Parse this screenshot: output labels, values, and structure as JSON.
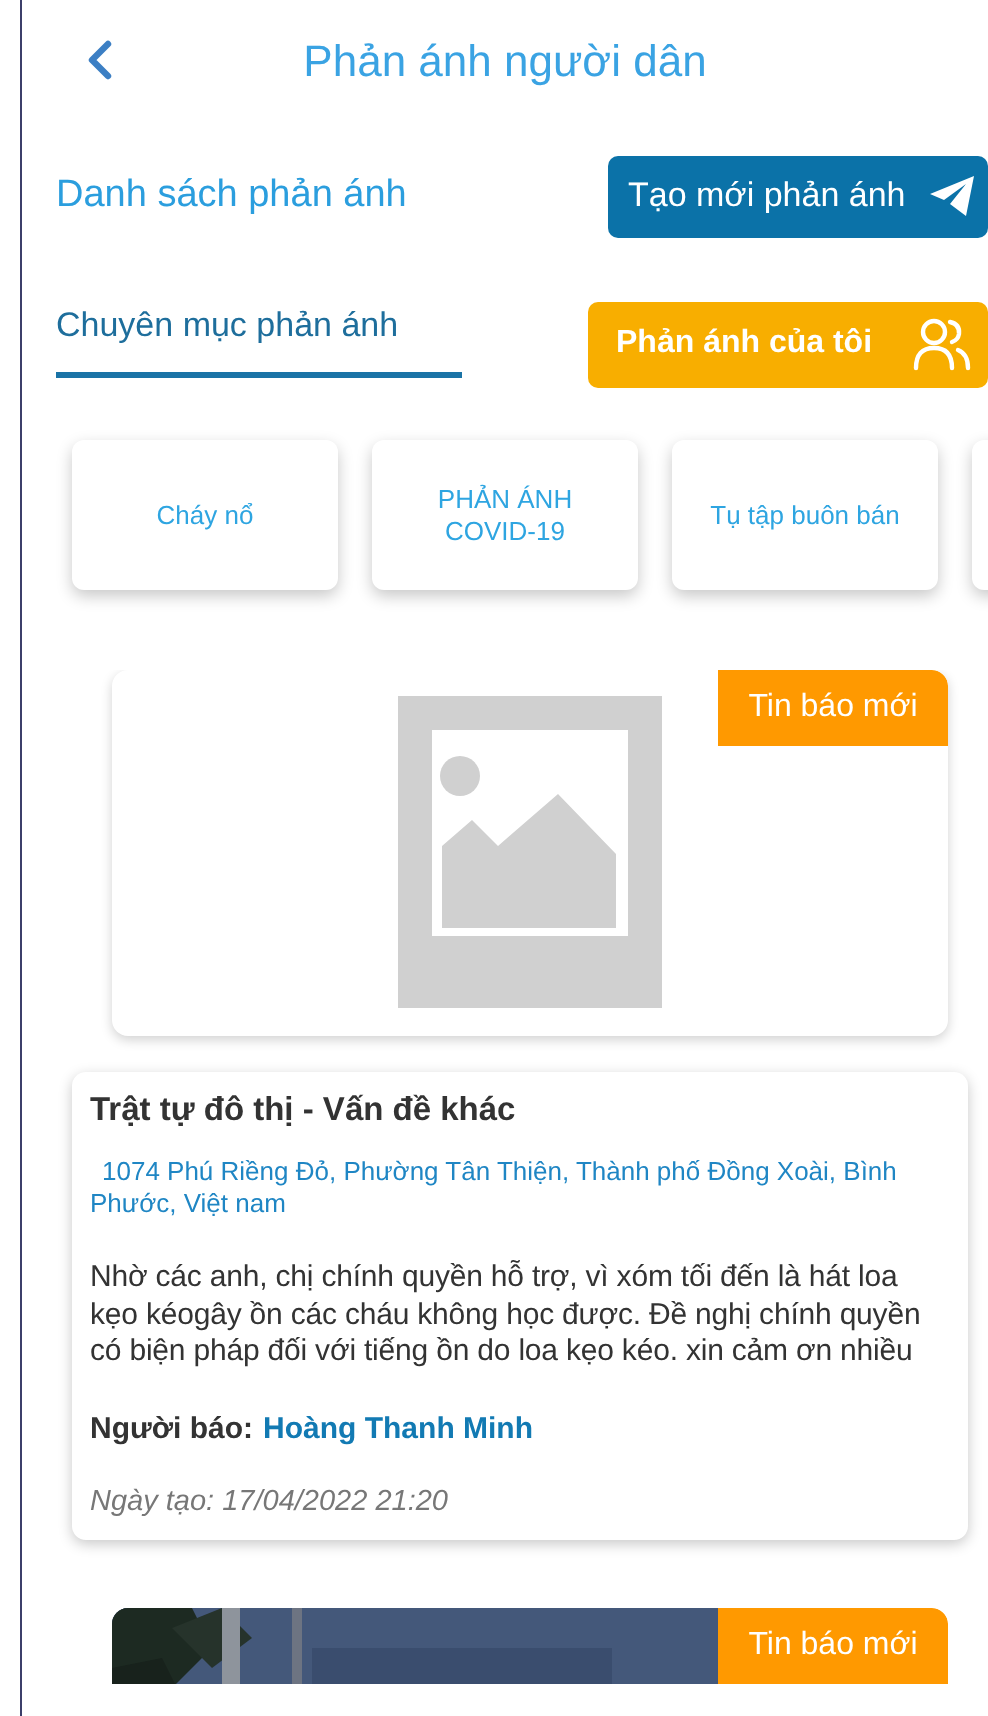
{
  "header": {
    "title": "Phản ánh người dân"
  },
  "section": {
    "title": "Danh sách phản ánh",
    "create_button": "Tạo mới phản ánh"
  },
  "tabs": [
    {
      "label": "Chuyên mục phản ánh",
      "selected": true
    }
  ],
  "my_reports_button": "Phản ánh của tôi",
  "categories": [
    {
      "label": "Cháy nổ"
    },
    {
      "label": "PHẢN ÁNH COVID-19"
    },
    {
      "label": "Tụ tập buôn bán"
    }
  ],
  "reports": [
    {
      "kind": "placeholder",
      "badge": "Tin báo mới",
      "title": "Trật tự đô thị - Vấn đề khác",
      "address": "1074 Phú Riềng Đỏ, Phường Tân Thiện, Thành phố Đồng Xoài, Bình Phước, Việt nam",
      "description": "Nhờ các anh, chị chính quyền hỗ trợ, vì xóm tối đến là hát loa kẹo kéogây ồn các cháu không học được.  Đề nghị chính quyền có biện pháp đối với tiếng ồn do loa kẹo kéo. xin cảm ơn nhiều",
      "reporter_label": "Người báo:",
      "reporter": "Hoàng Thanh Minh",
      "created": "Ngày tạo: 17/04/2022 21:20"
    },
    {
      "kind": "picture",
      "badge": "Tin báo mới"
    }
  ]
}
